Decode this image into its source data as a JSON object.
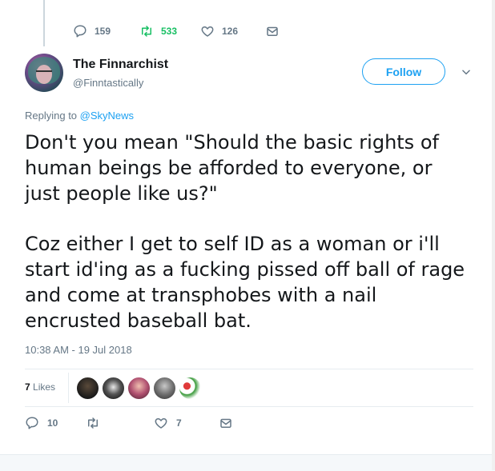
{
  "top_stats": {
    "replies": "159",
    "retweets": "533",
    "likes": "126"
  },
  "tweet": {
    "display_name": "The Finnarchist",
    "handle": "@Finntastically",
    "follow_label": "Follow",
    "replying_prefix": "Replying to",
    "replying_to": "@SkyNews",
    "text_lines_p1": [
      "Don't you mean \"Should the basic rights of",
      "human beings be afforded to everyone, or",
      "just people like us?\""
    ],
    "text_lines_p2": [
      "Coz either I get to self ID as a woman or i'll",
      "start id'ing as a fucking pissed off ball of rage",
      "and come at transphobes with a nail",
      "encrusted baseball bat."
    ],
    "timestamp": "10:38 AM - 19 Jul 2018",
    "likes_count": "7",
    "likes_label": "Likes",
    "actions": {
      "replies": "10",
      "retweets": "",
      "likes": "7"
    }
  },
  "colors": {
    "accent": "#1da1f2",
    "retweet": "#17bf63",
    "muted": "#657786"
  },
  "likers": [
    "liker-avatar-1",
    "liker-avatar-2",
    "liker-avatar-3",
    "liker-avatar-4",
    "liker-avatar-5"
  ]
}
